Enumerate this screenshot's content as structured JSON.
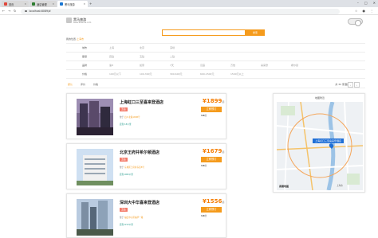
{
  "browser": {
    "tabs": [
      {
        "label": "首页"
      },
      {
        "label": "酒店管理"
      },
      {
        "label": "黑马旅游"
      }
    ],
    "url": "localhost:8089/#"
  },
  "site": {
    "name": "黑马旅游",
    "subtitle": "www.itheima.com",
    "search_placeholder": "",
    "search_button": "搜索",
    "city_label": "我的位置:",
    "city_value": "上海市"
  },
  "filters": [
    {
      "label": "城市",
      "options": [
        "上海",
        "北京",
        "深圳"
      ]
    },
    {
      "label": "星级",
      "options": [
        "四钻",
        "五钻",
        "二钻"
      ]
    },
    {
      "label": "品牌",
      "options": [
        "速8",
        "如家",
        "7天",
        "汉庭",
        "万怡",
        "喜来登",
        "希尔顿"
      ]
    },
    {
      "label": "价格",
      "options": [
        "100元以下",
        "100-300元",
        "300-600元",
        "600-1500元",
        "1500元以上"
      ]
    }
  ],
  "sort": {
    "items": [
      "默认",
      "评价",
      "价格"
    ],
    "result_text": "共 32 家酒店"
  },
  "hotels": [
    {
      "name": "上海虹口三至喜来登酒店",
      "badge": "五钻",
      "address": "四川北路1688号",
      "address_prefix": "位于",
      "near": "距您3.8公里",
      "price": "1899",
      "price_unit": "起",
      "book": "立即预订",
      "score": "4.6",
      "score_label": "分"
    },
    {
      "name": "北京王府井希尔顿酒店",
      "badge": "五钻",
      "address": "东城区王府井东街8号",
      "address_prefix": "位于",
      "near": "距您1082公里",
      "price": "1679",
      "price_unit": "起",
      "book": "立即预订",
      "score": "4.6",
      "score_label": "分"
    },
    {
      "name": "深圳大中华喜来登酒店",
      "badge": "五钻",
      "address": "福田中心区福华一路",
      "address_prefix": "位于",
      "near": "距您1212公里",
      "price": "1556",
      "price_unit": "起",
      "book": "立即预订",
      "score": "4.6",
      "score_label": "分"
    }
  ],
  "map": {
    "title": "地图附近",
    "label": "上海虹口三至喜来登酒店",
    "logo": "高德地图",
    "city": "上海市"
  },
  "colors": {
    "accent": "#f59b1c",
    "badge": "#f37b6a",
    "map_label": "#1f6fd6"
  }
}
